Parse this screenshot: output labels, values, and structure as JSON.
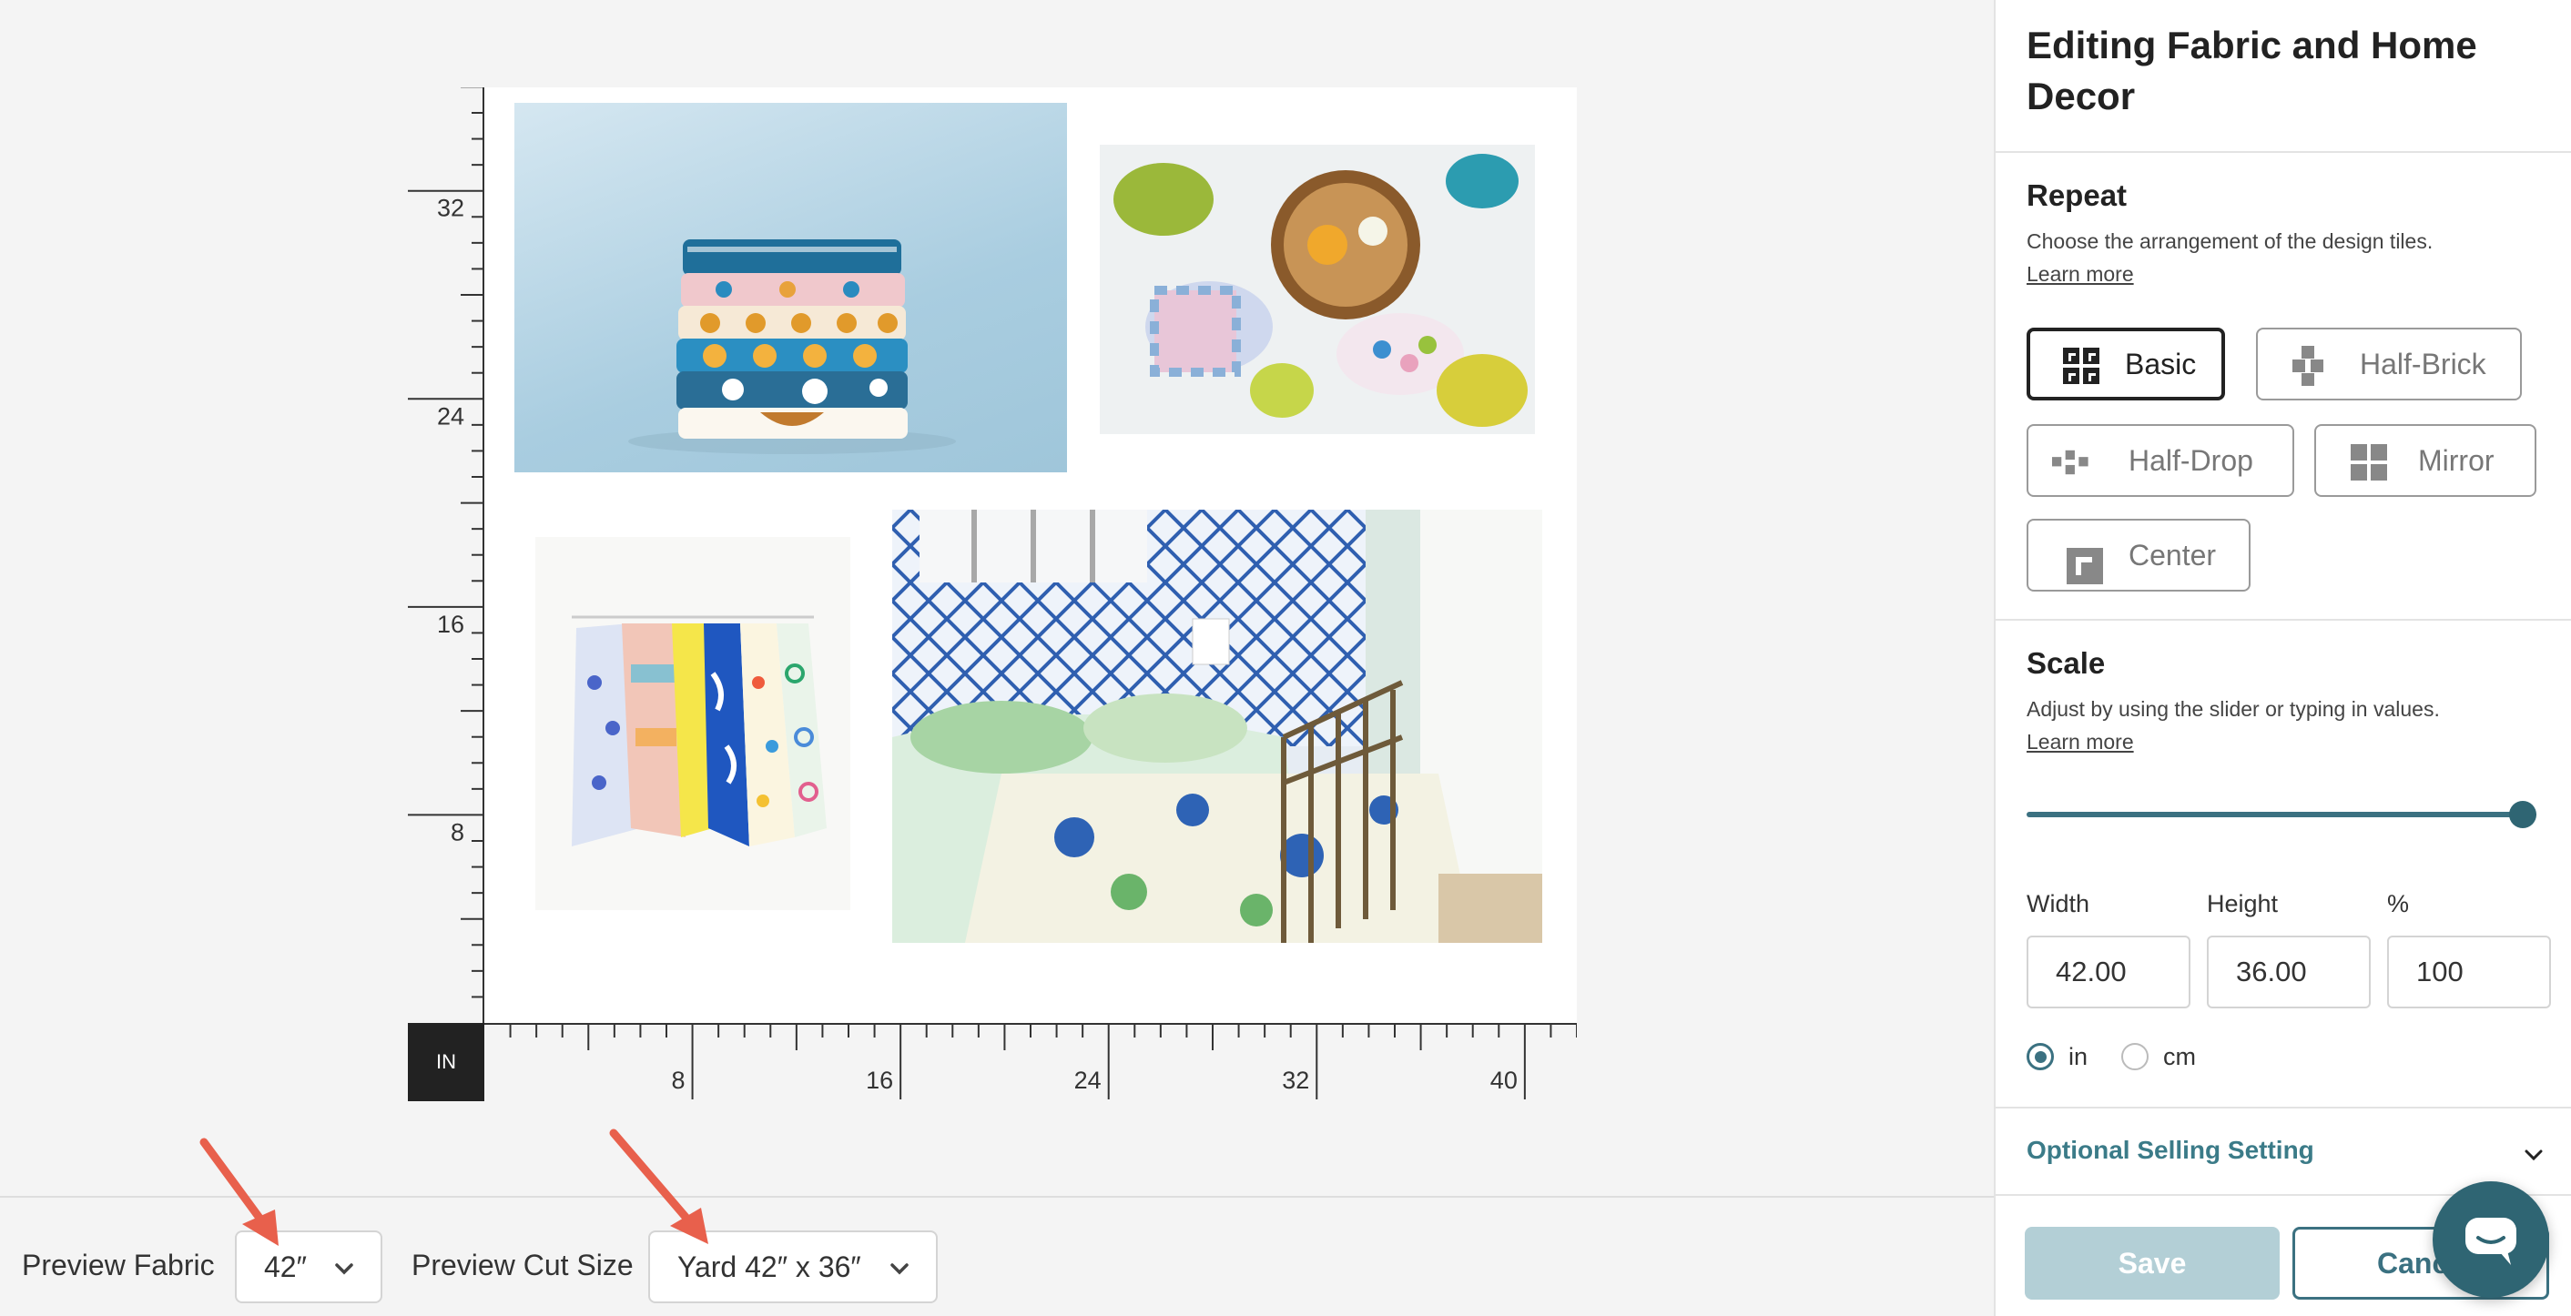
{
  "panel": {
    "title": "Editing Fabric and Home Decor",
    "repeat": {
      "title": "Repeat",
      "description": "Choose the arrangement of the design tiles.",
      "learn_more": "Learn more",
      "options": [
        {
          "label": "Basic",
          "icon": "basic-repeat-icon",
          "selected": true
        },
        {
          "label": "Half-Brick",
          "icon": "half-brick-icon",
          "selected": false
        },
        {
          "label": "Half-Drop",
          "icon": "half-drop-icon",
          "selected": false
        },
        {
          "label": "Mirror",
          "icon": "mirror-icon",
          "selected": false
        },
        {
          "label": "Center",
          "icon": "center-icon",
          "selected": false
        }
      ]
    },
    "scale": {
      "title": "Scale",
      "description": "Adjust by using the slider or typing in values.",
      "learn_more": "Learn more",
      "slider_fraction": 1.0,
      "width_label": "Width",
      "height_label": "Height",
      "percent_label": "%",
      "width_value": "42.00",
      "height_value": "36.00",
      "percent_value": "100",
      "unit_in": "in",
      "unit_cm": "cm",
      "selected_unit": "in"
    },
    "optional_selling": "Optional Selling Setting",
    "save_label": "Save",
    "cancel_label": "Cancel"
  },
  "canvas": {
    "unit_label": "IN",
    "vertical_ticks": [
      "32",
      "24",
      "16",
      "8"
    ],
    "horizontal_ticks": [
      "8",
      "16",
      "24",
      "32",
      "40"
    ]
  },
  "bottom_bar": {
    "preview_fabric_label": "Preview Fabric",
    "preview_fabric_value": "42″",
    "preview_cut_label": "Preview Cut Size",
    "preview_cut_value": "Yard 42″ x 36″"
  },
  "colors": {
    "accent": "#3b7181",
    "arrow": "#e8604c",
    "save_disabled": "#b3cfd6"
  }
}
